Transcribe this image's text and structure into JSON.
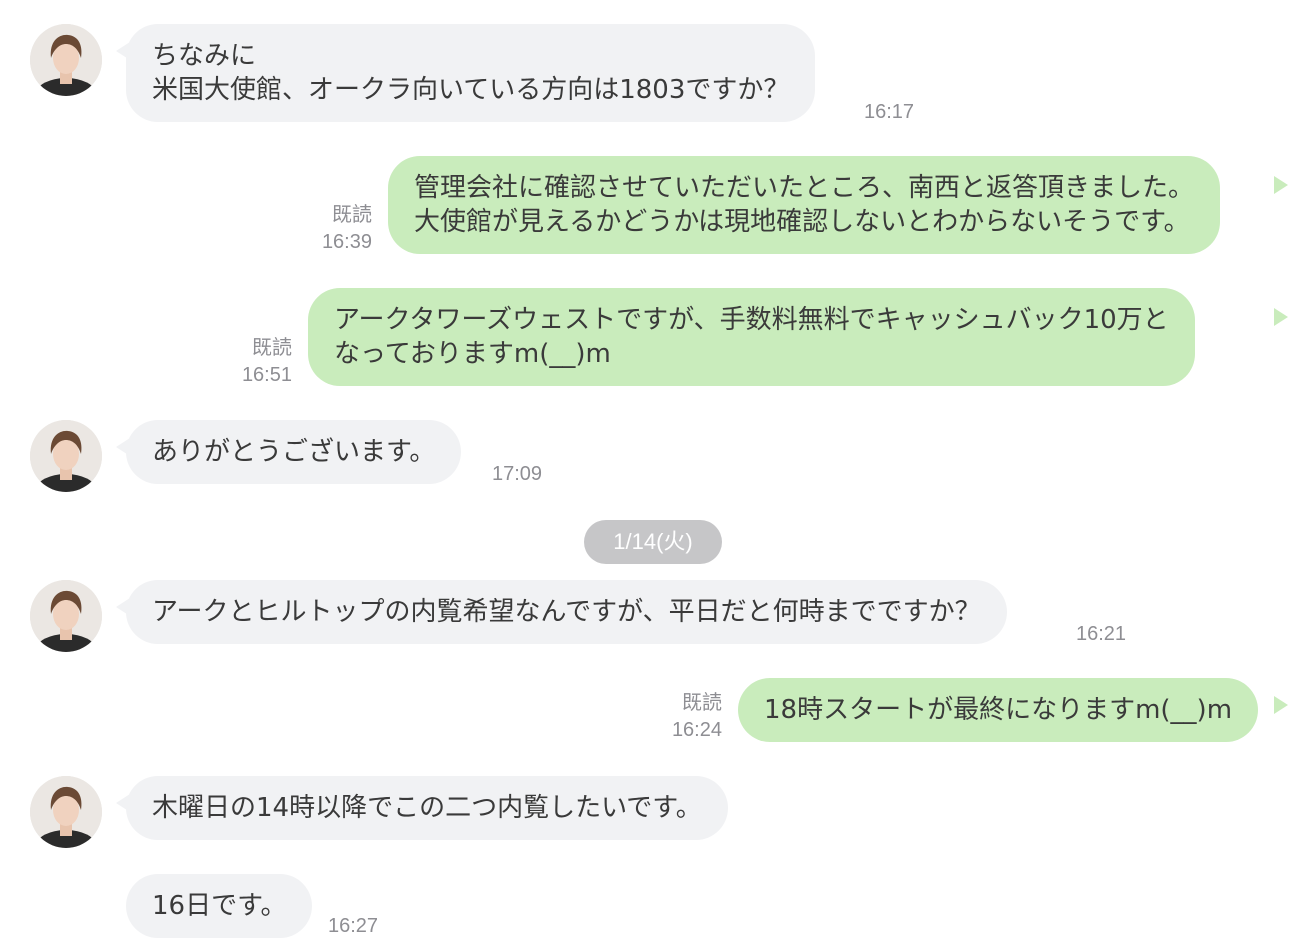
{
  "messages": [
    {
      "direction": "in",
      "lines": [
        "ちなみに",
        "米国大使館、オークラ向いている方向は1803ですか？"
      ],
      "time": "16:17"
    },
    {
      "direction": "out",
      "lines": [
        "管理会社に確認させていただいたところ、南西と返答頂きました。",
        "大使館が見えるかどうかは現地確認しないとわからないそうです。"
      ],
      "read": "既読",
      "time": "16:39"
    },
    {
      "direction": "out",
      "lines": [
        "アークタワーズウェストですが、手数料無料でキャッシュバック10万と",
        "なっておりますm(__)m"
      ],
      "read": "既読",
      "time": "16:51"
    },
    {
      "direction": "in",
      "lines": [
        "ありがとうございます。"
      ],
      "time": "17:09"
    },
    {
      "direction": "in",
      "lines": [
        "アークとヒルトップの内覧希望なんですが、平日だと何時までですか？"
      ],
      "time": "16:21"
    },
    {
      "direction": "out",
      "lines": [
        "18時スタートが最終になりますm(__)m"
      ],
      "read": "既読",
      "time": "16:24"
    },
    {
      "direction": "in",
      "lines": [
        "木曜日の14時以降でこの二つ内覧したいです。"
      ]
    },
    {
      "direction": "in",
      "lines": [
        "16日です。"
      ],
      "time": "16:27"
    }
  ],
  "date_separator": "1/14(火)",
  "colors": {
    "incoming_bubble": "#f1f2f4",
    "outgoing_bubble": "#c9ecbc",
    "date_pill": "#c6c6c8",
    "meta_text": "#8e8e93"
  }
}
